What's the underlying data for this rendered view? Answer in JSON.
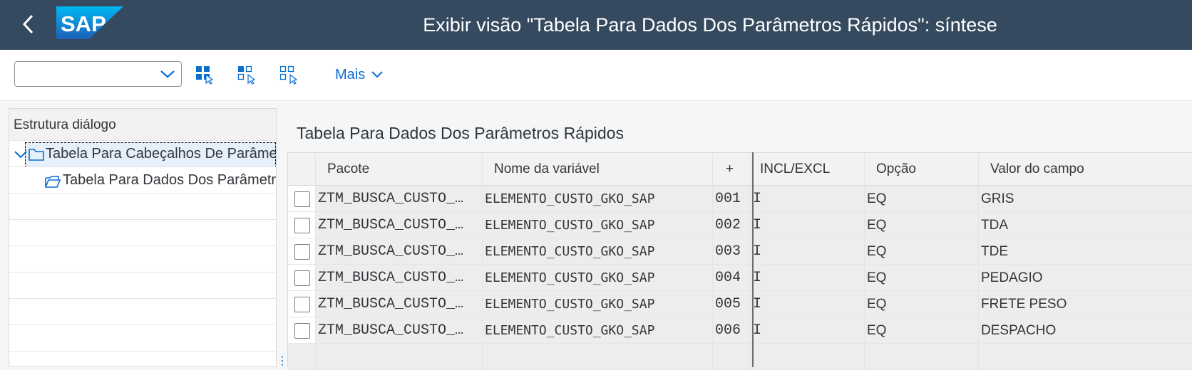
{
  "header": {
    "title": "Exibir visão \"Tabela Para Dados Dos Parâmetros Rápidos\": síntese",
    "logo_text": "SAP",
    "bg_color": "#354a5f"
  },
  "toolbar": {
    "dropdown_value": "",
    "icons": [
      "select-all-icon",
      "select-block-icon",
      "deselect-all-icon"
    ],
    "more_label": "Mais"
  },
  "tree": {
    "header": "Estrutura diálogo",
    "items": [
      {
        "label": "Tabela Para Cabeçalhos De Parâmetros Rápidos",
        "icon": "folder-icon",
        "expanded": true,
        "focused": true
      },
      {
        "label": "Tabela Para Dados Dos Parâmetros Rápidos",
        "icon": "open-folder-icon"
      }
    ]
  },
  "table": {
    "title": "Tabela Para Dados Dos Parâmetros Rápidos",
    "columns": [
      "Pacote",
      "Nome da variável",
      "+",
      "INCL/EXCL",
      "Opção",
      "Valor do campo"
    ],
    "rows": [
      [
        "ZTM_BUSCA_CUSTO_…",
        "ELEMENTO_CUSTO_GKO_SAP",
        "001",
        "I",
        "EQ",
        "GRIS"
      ],
      [
        "ZTM_BUSCA_CUSTO_…",
        "ELEMENTO_CUSTO_GKO_SAP",
        "002",
        "I",
        "EQ",
        "TDA"
      ],
      [
        "ZTM_BUSCA_CUSTO_…",
        "ELEMENTO_CUSTO_GKO_SAP",
        "003",
        "I",
        "EQ",
        "TDE"
      ],
      [
        "ZTM_BUSCA_CUSTO_…",
        "ELEMENTO_CUSTO_GKO_SAP",
        "004",
        "I",
        "EQ",
        "PEDAGIO"
      ],
      [
        "ZTM_BUSCA_CUSTO_…",
        "ELEMENTO_CUSTO_GKO_SAP",
        "005",
        "I",
        "EQ",
        "FRETE PESO"
      ],
      [
        "ZTM_BUSCA_CUSTO_…",
        "ELEMENTO_CUSTO_GKO_SAP",
        "006",
        "I",
        "EQ",
        "DESPACHO"
      ]
    ]
  },
  "colors": {
    "accent": "#0a6ed1",
    "header_bg": "#354a5f"
  }
}
